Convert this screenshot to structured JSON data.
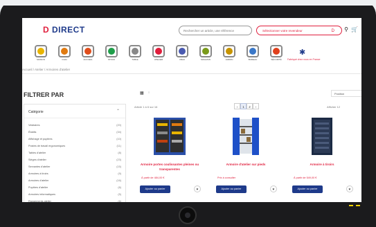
{
  "brand": {
    "logo_mark": "D",
    "logo_text": "DIRECT",
    "accent": "#e01e3c",
    "primary": "#1e3a8a"
  },
  "header": {
    "search_placeholder": "Rechercher un article, une référence",
    "dealer_label": "Sélectionner votre revendeur",
    "dealer_tag": "D",
    "icons": [
      "user-icon",
      "cart-icon",
      "pin-icon"
    ]
  },
  "categories": [
    {
      "label": "MAISON",
      "color": "#e8b400"
    },
    {
      "label": "CHAI",
      "color": "#e07a10"
    },
    {
      "label": "ACCUEIL",
      "color": "#e04e1c"
    },
    {
      "label": "STOCK",
      "color": "#1f9e4a"
    },
    {
      "label": "TABLE",
      "color": "#888888"
    },
    {
      "label": "ATELIER",
      "color": "#e01e3c"
    },
    {
      "label": "VRAC",
      "color": "#4a5ab0"
    },
    {
      "label": "MAGASIN",
      "color": "#7a9a1a"
    },
    {
      "label": "JARDIN",
      "color": "#c79400"
    },
    {
      "label": "BUREAU",
      "color": "#3a78c8"
    },
    {
      "label": "SÉCURITÉ",
      "color": "#e0401c"
    }
  ],
  "made_in_france": "Fabriqué chez nous en France",
  "breadcrumb": "Accueil / Atelier / Armoires d'atelier",
  "sidebar": {
    "title": "FILTRER PAR",
    "panel_title": "Catégorie",
    "items": [
      {
        "label": "Vestiaires",
        "count": "(20)"
      },
      {
        "label": "Établis",
        "count": "(34)"
      },
      {
        "label": "Affichage et pupitres",
        "count": "(10)"
      },
      {
        "label": "Postes de travail ergonomiques",
        "count": "(11)"
      },
      {
        "label": "Tables d'atelier",
        "count": "(8)"
      },
      {
        "label": "Sièges d'atelier",
        "count": "(23)"
      },
      {
        "label": "Servantes d'atelier",
        "count": "(15)"
      },
      {
        "label": "Armoires à tiroirs",
        "count": "(9)"
      },
      {
        "label": "Armoires d'atelier",
        "count": "(16)"
      },
      {
        "label": "Pupitres d'atelier",
        "count": "(6)"
      },
      {
        "label": "Armoires informatiques",
        "count": "(5)"
      },
      {
        "label": "Rangements atelier",
        "count": "(6)"
      }
    ]
  },
  "toolbar": {
    "view_label": "≡",
    "sort_label": "Position",
    "count_text": "Article 1 à 6 sur 16",
    "pages": [
      "‹",
      "1",
      "2",
      "›"
    ],
    "per_page": "Afficher  12"
  },
  "products": [
    {
      "title": "Armoire portes coulissantes pleines ou transparentes",
      "price": "À partir de 484,00 €",
      "cart": "Ajouter au panier"
    },
    {
      "title": "Armoire d'atelier sur pieds",
      "price": "Prix à consulter",
      "cart": "Ajouter au panier"
    },
    {
      "title": "Armoire à tiroirs",
      "price": "À partir de 549,00 €",
      "cart": "Ajouter au panier"
    }
  ]
}
